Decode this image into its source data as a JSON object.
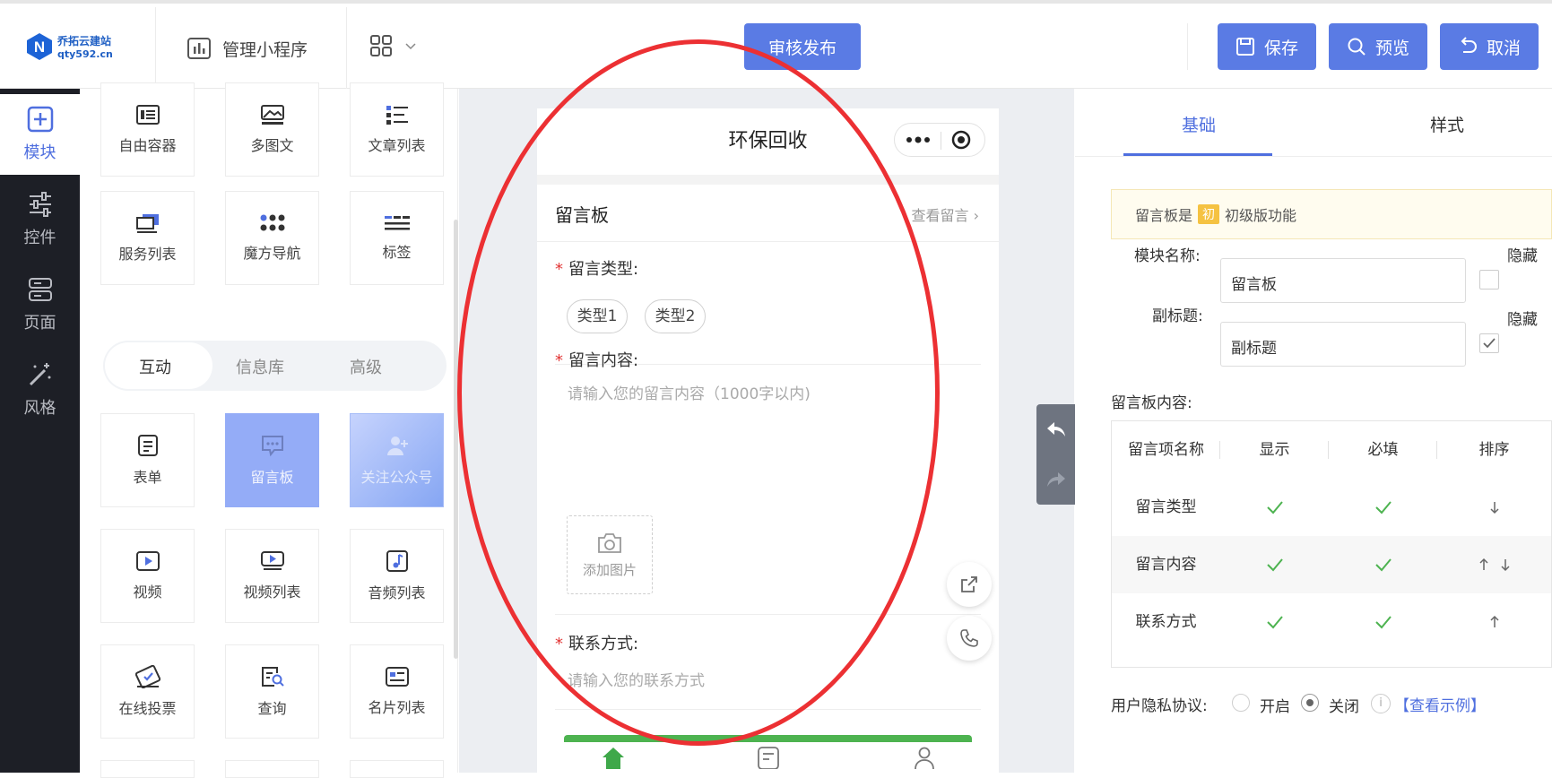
{
  "brand": {
    "logo_line1": "乔拓云建站",
    "logo_line2": "qty592.cn",
    "logo_letter": "N"
  },
  "header": {
    "manage_label": "管理小程序",
    "publish_label": "审核发布",
    "save_label": "保存",
    "preview_label": "预览",
    "cancel_label": "取消"
  },
  "nav": {
    "items": [
      {
        "label": "模块",
        "icon": "plus-square-icon"
      },
      {
        "label": "控件",
        "icon": "sliders-icon"
      },
      {
        "label": "页面",
        "icon": "server-icon"
      },
      {
        "label": "风格",
        "icon": "magic-wand-icon"
      }
    ]
  },
  "modules": {
    "top": [
      {
        "label": "自由容器",
        "icon": "container-icon"
      },
      {
        "label": "多图文",
        "icon": "image-text-icon"
      },
      {
        "label": "文章列表",
        "icon": "article-list-icon"
      },
      {
        "label": "服务列表",
        "icon": "service-list-icon"
      },
      {
        "label": "魔方导航",
        "icon": "cube-nav-icon"
      },
      {
        "label": "标签",
        "icon": "tag-icon"
      }
    ],
    "tabs": [
      "互动",
      "信息库",
      "高级"
    ],
    "interactive": [
      {
        "label": "表单",
        "icon": "form-icon"
      },
      {
        "label": "留言板",
        "icon": "message-board-icon"
      },
      {
        "label": "关注公众号",
        "icon": "follow-account-icon"
      },
      {
        "label": "视频",
        "icon": "video-icon"
      },
      {
        "label": "视频列表",
        "icon": "video-list-icon"
      },
      {
        "label": "音频列表",
        "icon": "audio-list-icon"
      },
      {
        "label": "在线投票",
        "icon": "vote-icon"
      },
      {
        "label": "查询",
        "icon": "query-icon"
      },
      {
        "label": "名片列表",
        "icon": "card-list-icon"
      }
    ]
  },
  "phone": {
    "title": "环保回收",
    "board_title": "留言板",
    "view_messages": "查看留言",
    "type_label": "留言类型:",
    "types": [
      "类型1",
      "类型2"
    ],
    "content_label": "留言内容:",
    "content_placeholder": "请输入您的留言内容（1000字以内)",
    "add_image": "添加图片",
    "contact_label": "联系方式:",
    "contact_placeholder": "请输入您的联系方式"
  },
  "right": {
    "tabs": [
      "基础",
      "样式"
    ],
    "notice_prefix": "留言板是",
    "notice_badge": "初",
    "notice_suffix": "初级版功能",
    "name_label": "模块名称:",
    "name_value": "留言板",
    "subtitle_label": "副标题:",
    "subtitle_value": "副标题",
    "hide_label": "隐藏",
    "content_label": "留言板内容:",
    "table_headers": [
      "留言项名称",
      "显示",
      "必填",
      "排序"
    ],
    "table_rows": [
      {
        "name": "留言类型",
        "show": true,
        "required": true,
        "sort": "down"
      },
      {
        "name": "留言内容",
        "show": true,
        "required": true,
        "sort": "up-down"
      },
      {
        "name": "联系方式",
        "show": true,
        "required": true,
        "sort": "up"
      }
    ],
    "privacy_label": "用户隐私协议:",
    "privacy_on": "开启",
    "privacy_off": "关闭",
    "privacy_selected": "关闭",
    "privacy_example": "【查看示例】"
  },
  "colors": {
    "accent": "#5a7be4",
    "sidebar": "#1d1f26",
    "annotation": "#ec3033",
    "check": "#4db350"
  }
}
